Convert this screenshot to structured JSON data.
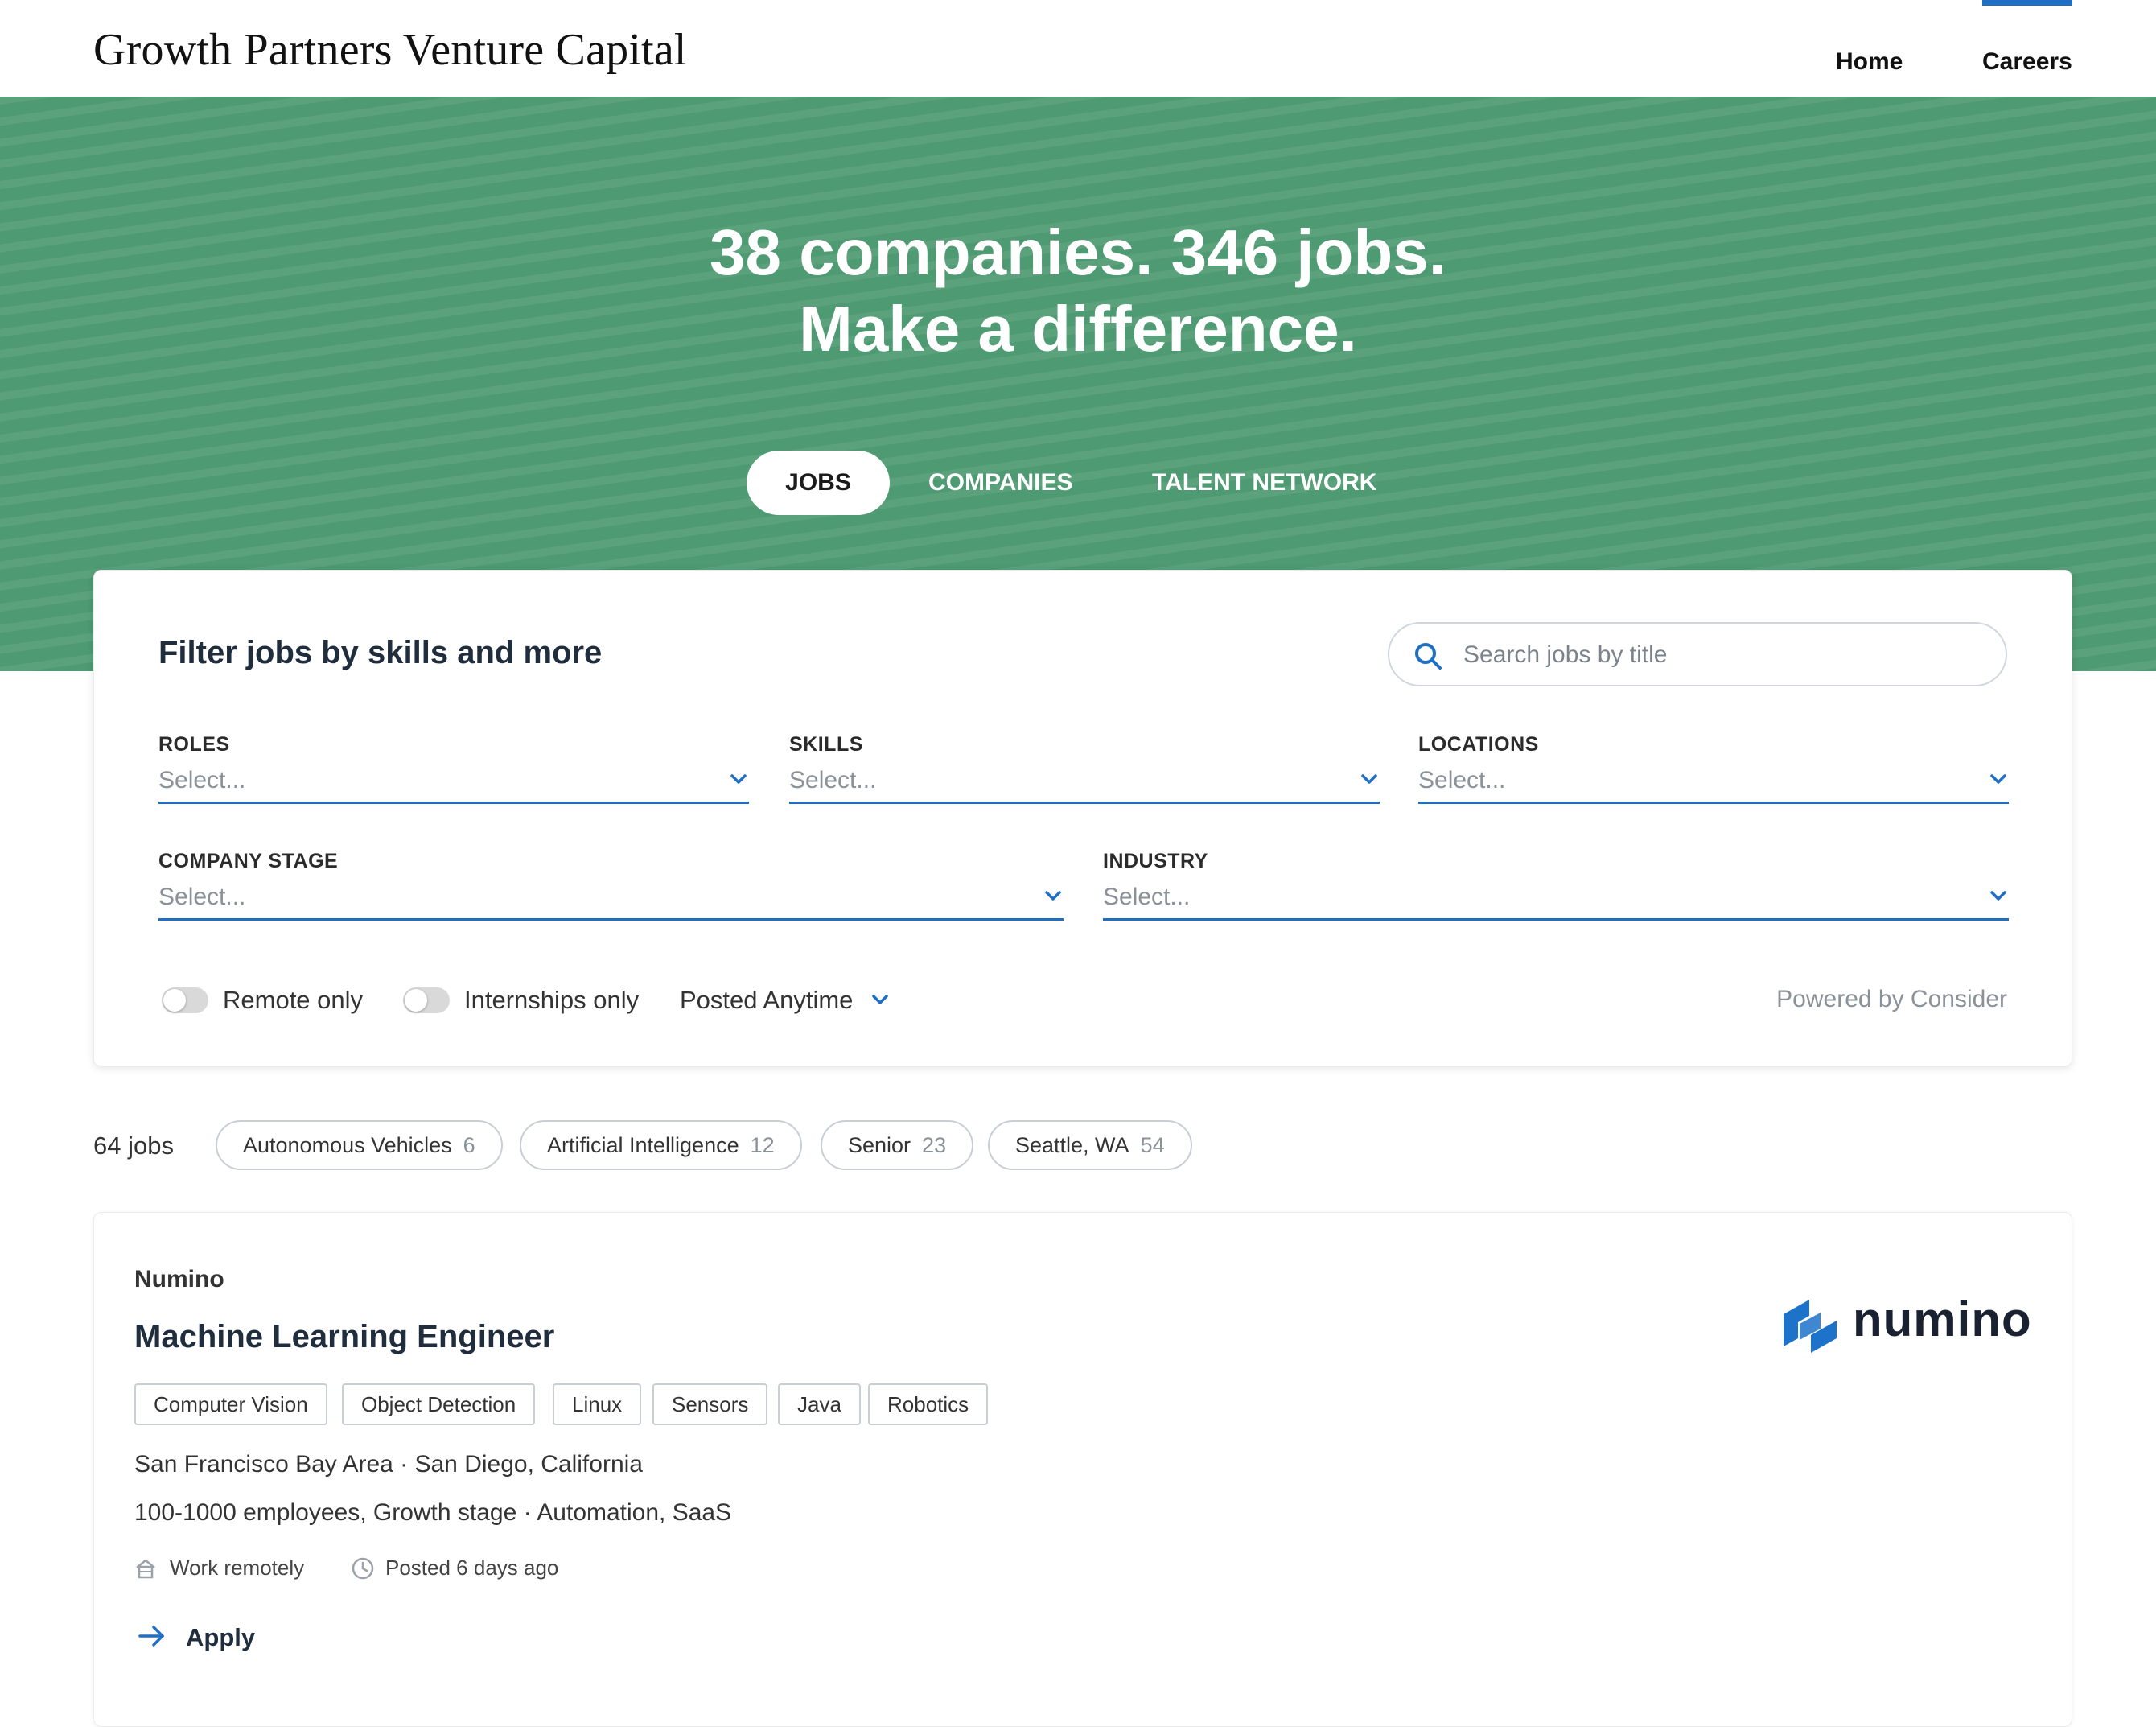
{
  "header": {
    "brand": "Growth Partners Venture Capital",
    "nav": {
      "home": "Home",
      "careers": "Careers"
    }
  },
  "hero": {
    "line1": "38 companies. 346 jobs.",
    "line2": "Make a difference.",
    "tabs": {
      "jobs": "JOBS",
      "companies": "COMPANIES",
      "talent_network": "TALENT NETWORK"
    }
  },
  "filters": {
    "title": "Filter jobs by skills and more",
    "search_placeholder": "Search jobs by title",
    "roles": {
      "label": "ROLES",
      "value": "Select..."
    },
    "skills": {
      "label": "SKILLS",
      "value": "Select..."
    },
    "locations": {
      "label": "LOCATIONS",
      "value": "Select..."
    },
    "company_stage": {
      "label": "COMPANY STAGE",
      "value": "Select..."
    },
    "industry": {
      "label": "INDUSTRY",
      "value": "Select..."
    },
    "remote_only": "Remote only",
    "internships_only": "Internships only",
    "posted": "Posted Anytime",
    "powered_by": "Powered by Consider"
  },
  "results": {
    "count": "64 jobs",
    "chips": [
      {
        "label": "Autonomous Vehicles",
        "count": "6"
      },
      {
        "label": "Artificial Intelligence",
        "count": "12"
      },
      {
        "label": "Senior",
        "count": "23"
      },
      {
        "label": "Seattle, WA",
        "count": "54"
      }
    ]
  },
  "job": {
    "company": "Numino",
    "title": "Machine Learning Engineer",
    "tags": [
      "Computer Vision",
      "Object Detection",
      "Linux",
      "Sensors",
      "Java",
      "Robotics"
    ],
    "locations": "San Francisco Bay Area · San Diego, California",
    "company_info": "100-1000 employees, Growth stage · Automation,  SaaS",
    "remote": "Work remotely",
    "posted": "Posted 6 days ago",
    "apply": "Apply",
    "logo_text": "numino"
  },
  "colors": {
    "hero_green": "#4e9a72",
    "accent_blue": "#1f6fc5",
    "logo_blue": "#1d72c9"
  },
  "icons": [
    "search-icon",
    "chevron-down-icon",
    "house-icon",
    "clock-icon",
    "arrow-right-icon",
    "numino-logo-icon"
  ]
}
